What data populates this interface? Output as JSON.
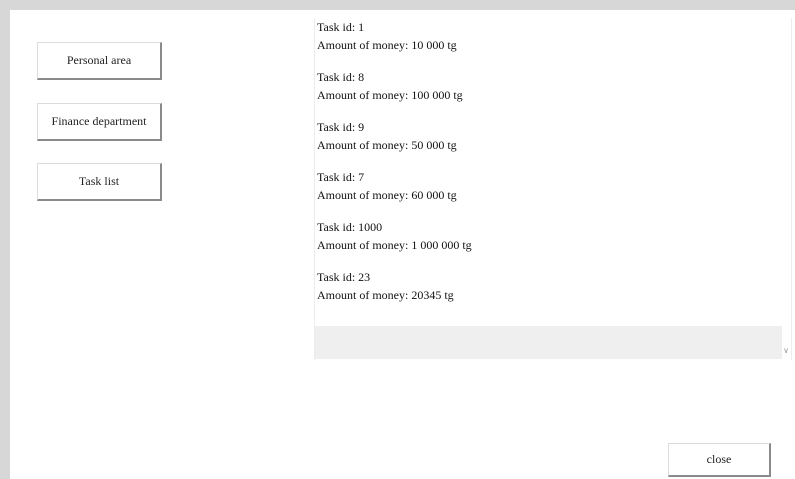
{
  "nav": {
    "personal_area": "Personal area",
    "finance_department": "Finance department",
    "task_list": "Task list"
  },
  "tasks": [
    {
      "id_line": "Task id: 1",
      "money_line": "Amount of money: 10 000 tg"
    },
    {
      "id_line": "Task id: 8",
      "money_line": "Amount of money: 100 000 tg"
    },
    {
      "id_line": "Task id: 9",
      "money_line": "Amount of money: 50 000 tg"
    },
    {
      "id_line": "Task id: 7",
      "money_line": "Amount of money: 60 000 tg"
    },
    {
      "id_line": "Task id: 1000",
      "money_line": "Amount of money: 1 000 000 tg"
    },
    {
      "id_line": "Task id: 23",
      "money_line": "Amount of money: 20345 tg"
    }
  ],
  "close_label": "close",
  "icons": {
    "scroll_down": "scroll-down-arrow"
  }
}
